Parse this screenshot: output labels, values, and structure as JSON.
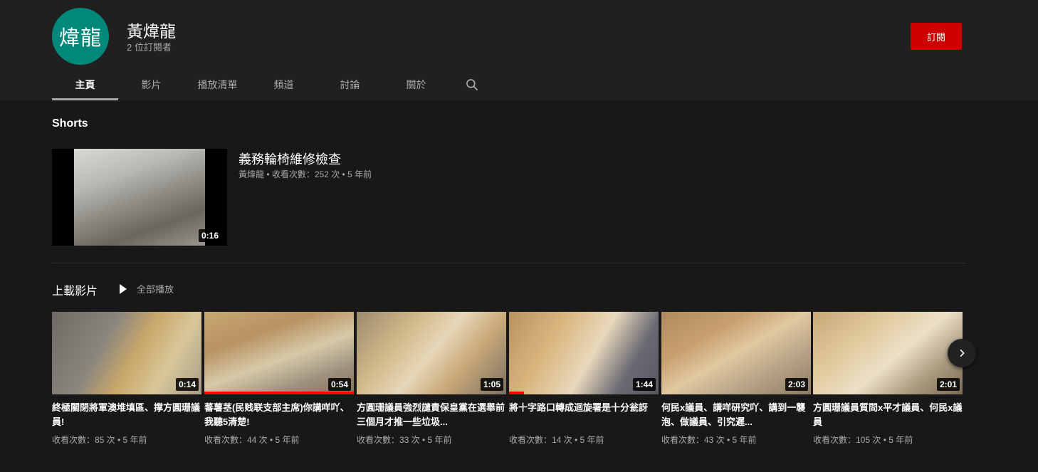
{
  "channel": {
    "avatar_text": "煒龍",
    "name": "黃煒龍",
    "subscribers": "2 位訂閱者",
    "subscribe_label": "訂閱"
  },
  "tabs": [
    {
      "label": "主頁",
      "active": true
    },
    {
      "label": "影片",
      "active": false
    },
    {
      "label": "播放清單",
      "active": false
    },
    {
      "label": "頻道",
      "active": false
    },
    {
      "label": "討論",
      "active": false
    },
    {
      "label": "關於",
      "active": false
    }
  ],
  "shorts": {
    "section_title": "Shorts",
    "video": {
      "title": "義務輪椅維修檢查",
      "meta": "黃煒龍 • 收看次數：252 次 • 5 年前",
      "duration": "0:16"
    }
  },
  "uploads": {
    "section_title": "上載影片",
    "play_all_label": "全部播放",
    "videos": [
      {
        "title": "終極關閉將軍澳堆填區、撑方圓珊議員!",
        "meta": "收看次數：85 次 • 5 年前",
        "duration": "0:14",
        "progress": 0
      },
      {
        "title": "蕃薯茎(民贱联支部主席)你講咩吖、我聽5清楚!",
        "meta": "收看次數：44 次 • 5 年前",
        "duration": "0:54",
        "progress": 1.0
      },
      {
        "title": "方圓珊議員強烈譴責保皇黨在選舉前三個月才推一些垃圾...",
        "meta": "收看次數：33 次 • 5 年前",
        "duration": "1:05",
        "progress": 0
      },
      {
        "title": "將十字路口轉成迴旋署是十分瓮訝",
        "meta": "收看次數：14 次 • 5 年前",
        "duration": "1:44",
        "progress": 0.1
      },
      {
        "title": "何民x議員、講咩研究吖、講到一襲泡、做議員、引究遲...",
        "meta": "收看次數：43 次 • 5 年前",
        "duration": "2:03",
        "progress": 0
      },
      {
        "title": "方圓珊議員質問x平才議員、何民x議員",
        "meta": "收看次數：105 次 • 5 年前",
        "duration": "2:01",
        "progress": 0
      }
    ]
  },
  "colors": {
    "subscribe": "#cc0000",
    "progress": "#ff0000",
    "avatar_bg": "#00897b"
  }
}
